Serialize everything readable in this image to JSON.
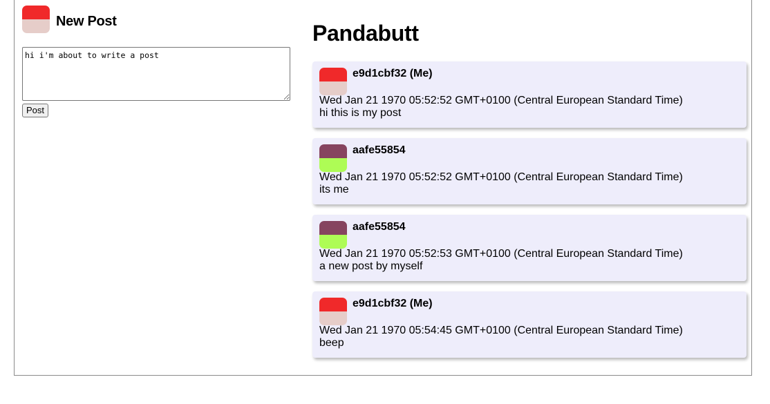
{
  "compose": {
    "title": "New Post",
    "text": "hi i'm about to write a post",
    "button_label": "Post",
    "avatar_colors": {
      "top": "#f0292a",
      "bottom": "#e6cdc9"
    }
  },
  "site": {
    "title": "Pandabutt"
  },
  "posts": [
    {
      "author": "e9d1cbf32 (Me)",
      "date": "Wed Jan 21 1970 05:52:52 GMT+0100 (Central European Standard Time)",
      "body": "hi this is my post",
      "avatar_colors": {
        "top": "#f0292a",
        "bottom": "#e6cdc9"
      }
    },
    {
      "author": "aafe55854",
      "date": "Wed Jan 21 1970 05:52:52 GMT+0100 (Central European Standard Time)",
      "body": "its me",
      "avatar_colors": {
        "top": "#86445f",
        "bottom": "#aefc55"
      }
    },
    {
      "author": "aafe55854",
      "date": "Wed Jan 21 1970 05:52:53 GMT+0100 (Central European Standard Time)",
      "body": "a new post by myself",
      "avatar_colors": {
        "top": "#86445f",
        "bottom": "#aefc55"
      }
    },
    {
      "author": "e9d1cbf32 (Me)",
      "date": "Wed Jan 21 1970 05:54:45 GMT+0100 (Central European Standard Time)",
      "body": "beep",
      "avatar_colors": {
        "top": "#f0292a",
        "bottom": "#e6cdc9"
      }
    }
  ]
}
